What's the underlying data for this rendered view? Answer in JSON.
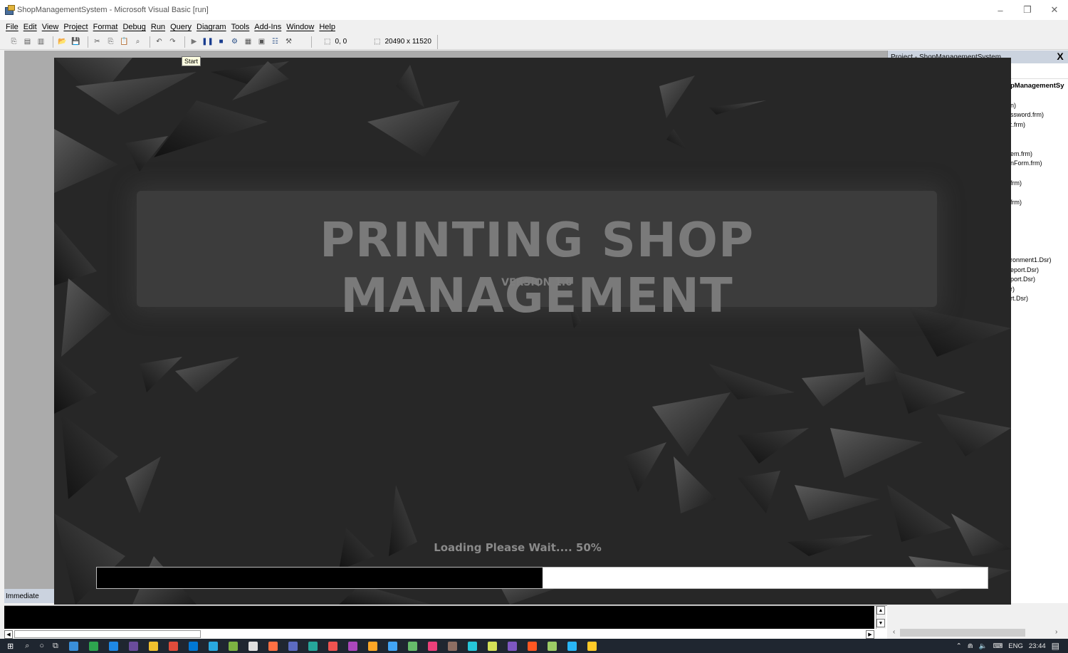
{
  "window": {
    "title": "ShopManagementSystem - Microsoft Visual Basic [run]",
    "controls": {
      "minimize": "–",
      "restore": "❐",
      "close": "✕"
    }
  },
  "menu": [
    "File",
    "Edit",
    "View",
    "Project",
    "Format",
    "Debug",
    "Run",
    "Query",
    "Diagram",
    "Tools",
    "Add-Ins",
    "Window",
    "Help"
  ],
  "toolbar": {
    "tooltip": "Start",
    "position_readout": "0, 0",
    "size_readout": "20490 x 11520"
  },
  "project_explorer": {
    "title": "Project - ShopManagementSystem",
    "close": "X",
    "root": "pManagementSy",
    "items": [
      "n)",
      "ssword.frm)",
      ":.frm)",
      "em.frm)",
      "nForm.frm)",
      "frm)",
      "frm)",
      "ronment1.Dsr)",
      "eport.Dsr)",
      "port.Dsr)",
      "r)",
      "rt.Dsr)"
    ]
  },
  "splash": {
    "title": "PRINTING SHOP MANAGEMENT",
    "version": "VERSION 1.0",
    "loading_text": "Loading Please Wait.... 50%",
    "progress": 0.5
  },
  "immediate": {
    "label": "Immediate"
  },
  "taskbar": {
    "tray_lang": "ENG",
    "clock": "23:44",
    "icon_colors": [
      "#3a8fd9",
      "#2ea44f",
      "#1e88e5",
      "#6a4c9c",
      "#f2c12e",
      "#e24c3b",
      "#0078d4",
      "#29a9e0",
      "#7cb342",
      "#e0e0e0",
      "#ff7043",
      "#5c6bc0",
      "#26a69a",
      "#ef5350",
      "#ab47bc",
      "#ffa726",
      "#42a5f5",
      "#66bb6a",
      "#ec407a",
      "#8d6e63",
      "#26c6da",
      "#d4e157",
      "#7e57c2",
      "#ff5722",
      "#9ccc65",
      "#29b6f6",
      "#ffca28"
    ]
  }
}
